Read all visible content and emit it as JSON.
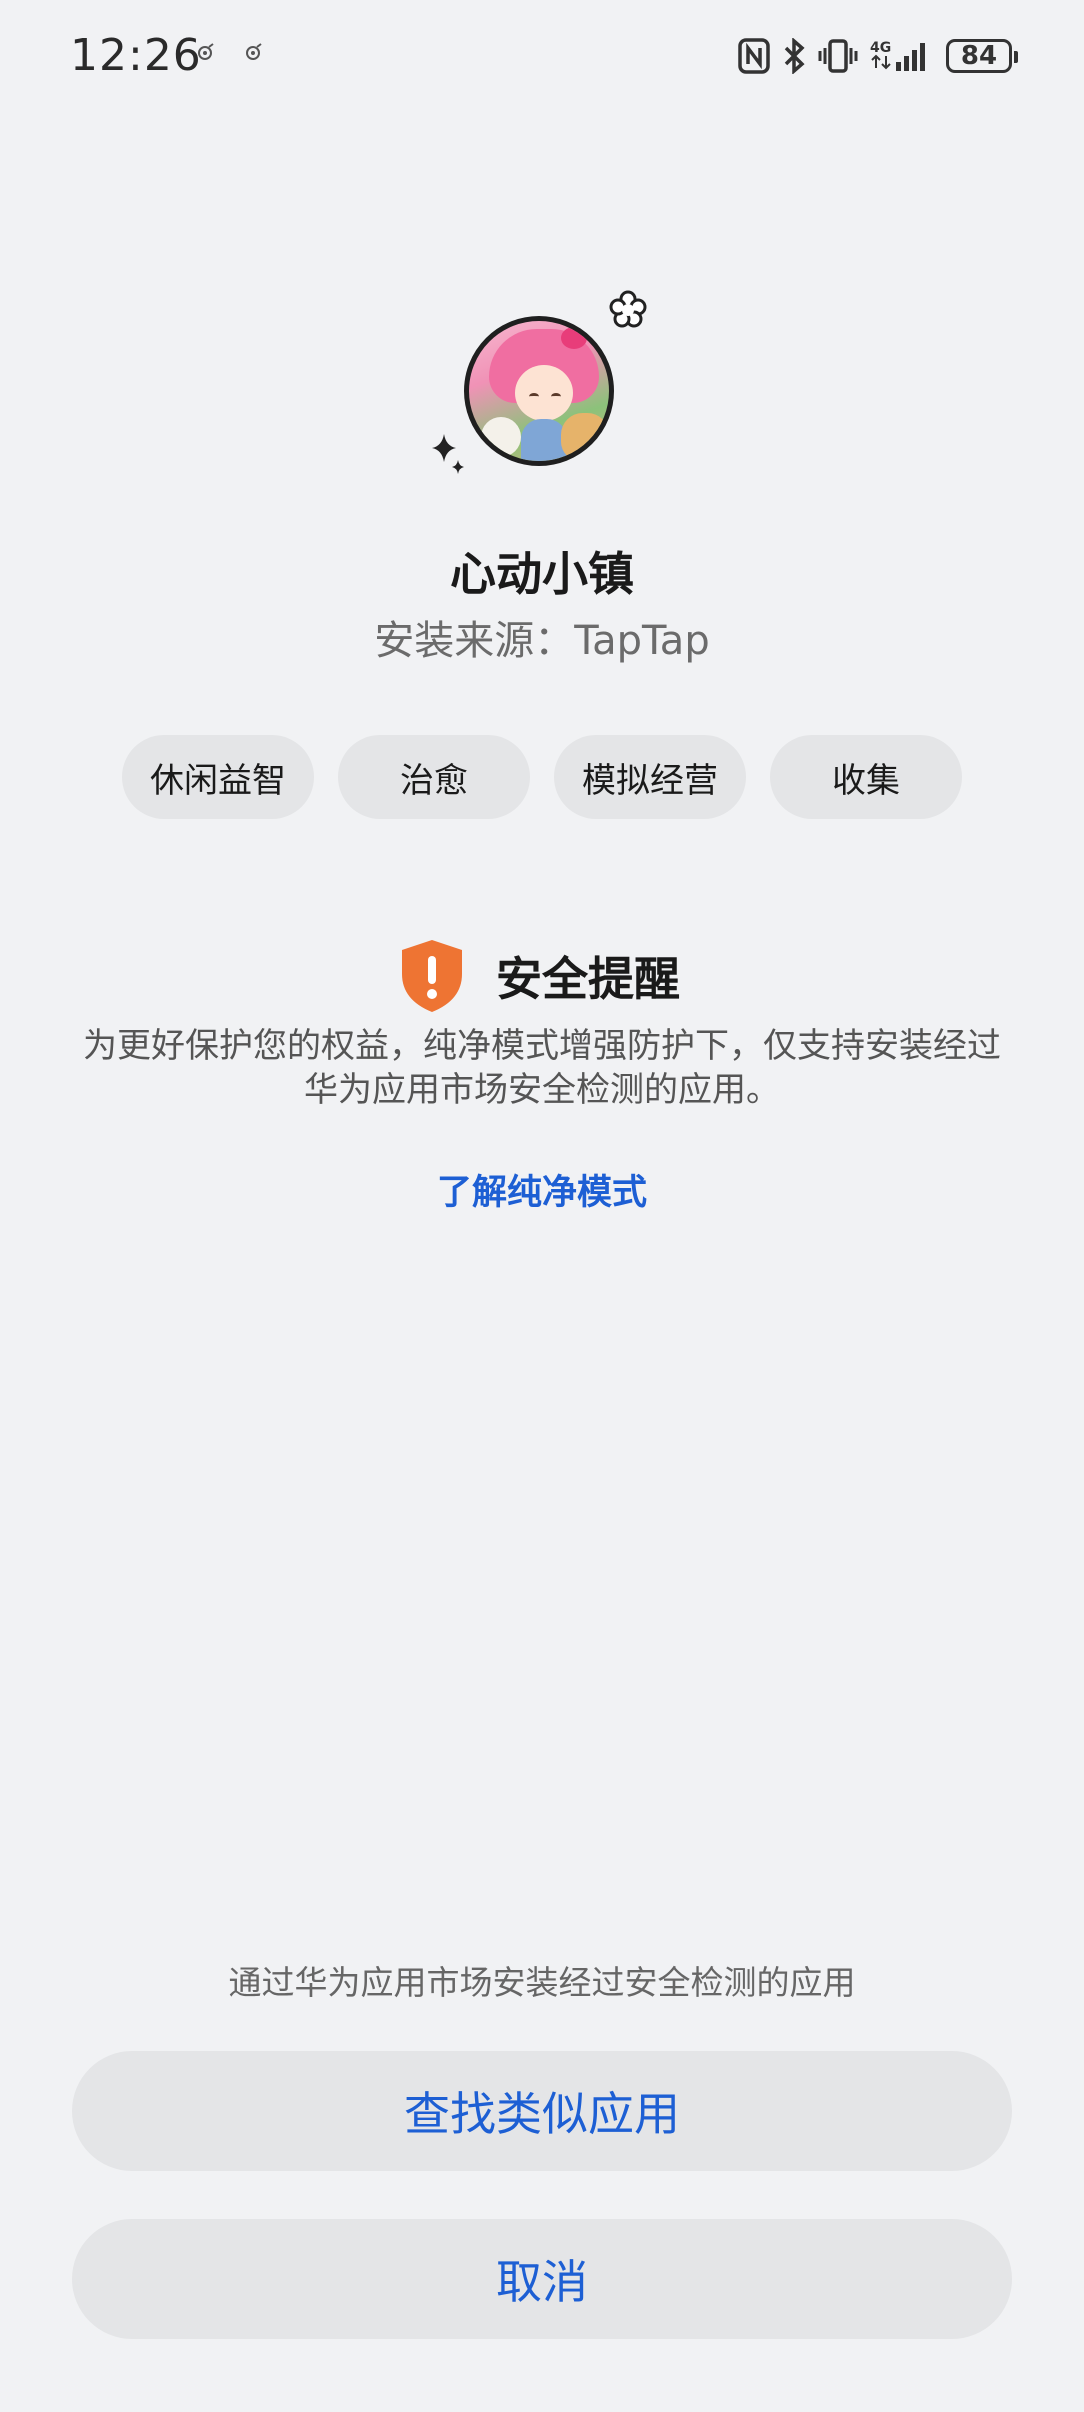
{
  "status_bar": {
    "time": "12:26",
    "network": "4G",
    "battery": "84"
  },
  "app": {
    "name": "心动小镇",
    "source": "安装来源：TapTap",
    "tags": [
      "休闲益智",
      "治愈",
      "模拟经营",
      "收集"
    ]
  },
  "security": {
    "title": "安全提醒",
    "description": "为更好保护您的权益，纯净模式增强防护下，仅支持安装经过华为应用市场安全检测的应用。",
    "learn_more": "了解纯净模式",
    "accent_color": "#ee7433"
  },
  "footer": {
    "hint": "通过华为应用市场安装经过安全检测的应用",
    "find_similar_label": "查找类似应用",
    "cancel_label": "取消",
    "link_color": "#1d5fd4"
  }
}
